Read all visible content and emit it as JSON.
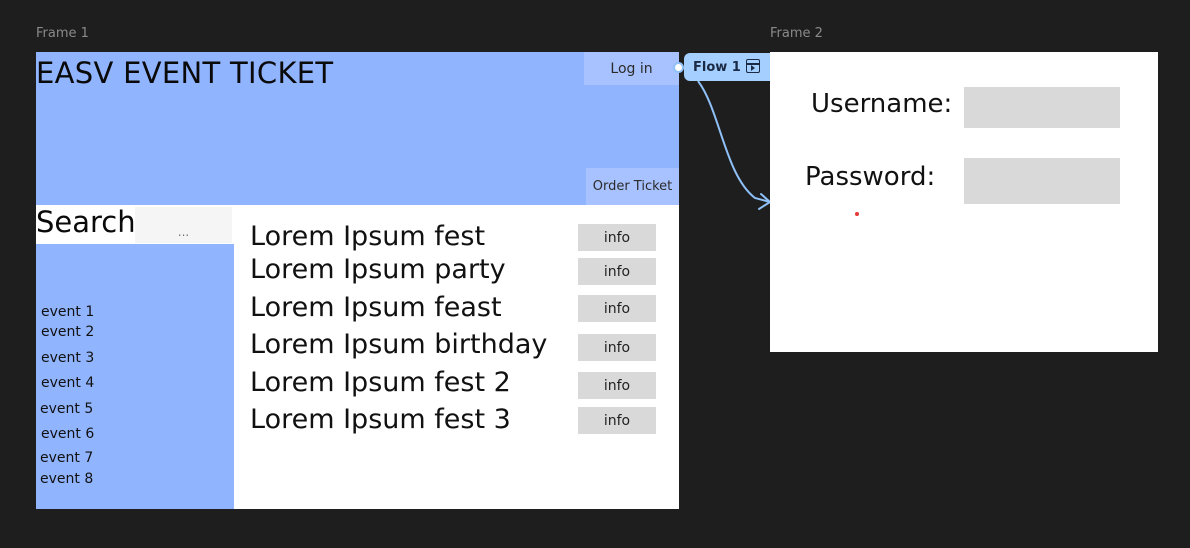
{
  "canvas": {
    "frame1_label": "Frame 1",
    "frame2_label": "Frame 2",
    "flow_label": "Flow 1",
    "colors": {
      "background": "#1e1e1e",
      "header": "#91b4ff",
      "button": "#a8c2ff",
      "info_button": "#d9d9d9",
      "flow": "#a5cfff",
      "connector": "#8fc0f8"
    }
  },
  "frame1": {
    "title": "EASV EVENT TICKET",
    "login_label": "Log in",
    "order_label": "Order Ticket",
    "search_label": "Search",
    "search_value": "...",
    "events": [
      "event 1",
      "event 2",
      "event 3",
      "event 4",
      "event 5",
      "event 6",
      "event 7",
      "event 8"
    ],
    "listings": [
      {
        "name": "Lorem Ipsum fest",
        "button": "info"
      },
      {
        "name": "Lorem Ipsum party",
        "button": "info"
      },
      {
        "name": "Lorem Ipsum feast",
        "button": "info"
      },
      {
        "name": "Lorem Ipsum birthday",
        "button": "info"
      },
      {
        "name": "Lorem Ipsum fest 2",
        "button": "info"
      },
      {
        "name": "Lorem Ipsum fest 3",
        "button": "info"
      }
    ]
  },
  "frame2": {
    "username_label": "Username:",
    "password_label": "Password:"
  }
}
